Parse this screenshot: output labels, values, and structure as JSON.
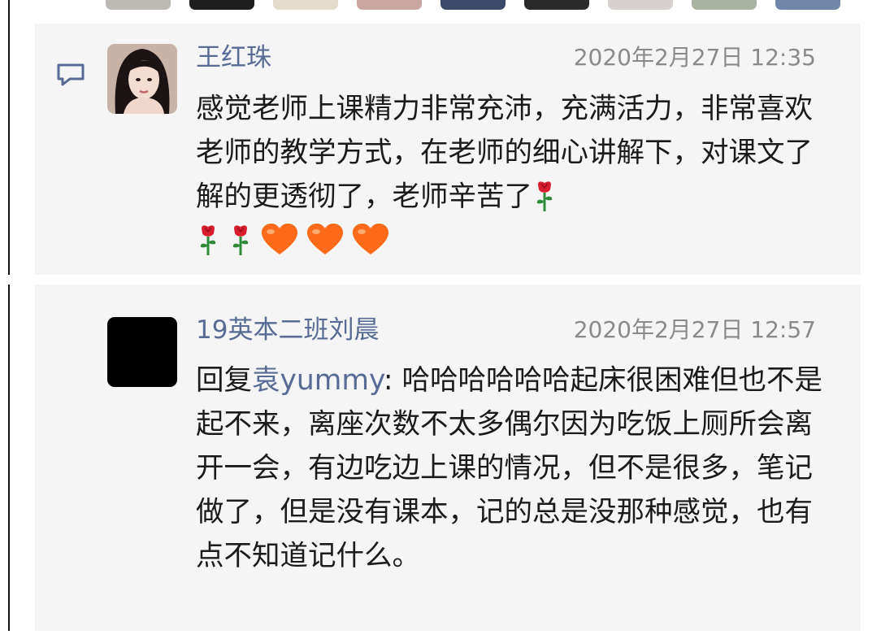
{
  "comments": [
    {
      "author": "王红珠",
      "time": "2020年2月27日 12:35",
      "text": "感觉老师上课精力非常充沛，充满活力，非常喜欢老师的教学方式，在老师的细心讲解下，对课文了解的更透彻了，老师辛苦了",
      "emojis": [
        "rose",
        "rose",
        "rose",
        "heart",
        "heart",
        "heart"
      ]
    },
    {
      "author": "19英本二班刘晨",
      "time": "2020年2月27日 12:57",
      "reply_prefix": "回复",
      "reply_to": "袁yummy",
      "text": ": 哈哈哈哈哈哈起床很困难但也不是起不来，离座次数不太多偶尔因为吃饭上厕所会离开一会，有边吃边上课的情况，但不是很多，笔记做了，但是没有课本，记的总是没那种感觉，也有点不知道记什么。"
    }
  ],
  "colors": {
    "link": "#576b95",
    "text": "#1b1b1b",
    "time": "#8a8a8a",
    "card_bg": "#f5f5f5",
    "rose": "#d81e2c",
    "heart": "#ff6a1a"
  },
  "icons": {
    "comment": "comment-bubble-icon",
    "rose": "rose-emoji",
    "heart": "orange-heart-emoji"
  }
}
